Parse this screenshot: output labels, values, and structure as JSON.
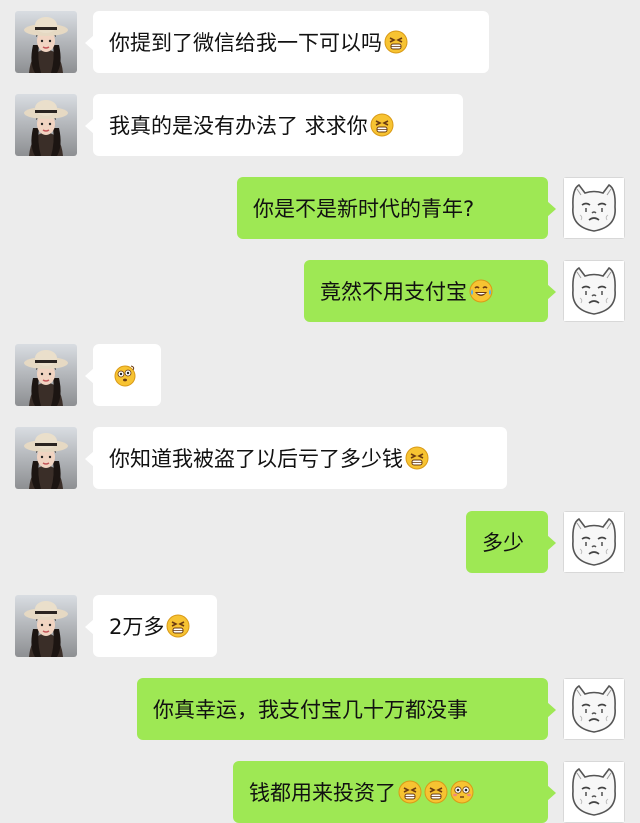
{
  "contact": {
    "avatar": "woman-straw-hat-avatar"
  },
  "self": {
    "avatar": "white-cat-cartoon-avatar"
  },
  "colors": {
    "background": "#ececec",
    "incoming_bubble": "#ffffff",
    "outgoing_bubble": "#9ee854",
    "text": "#111111"
  },
  "messages": [
    {
      "side": "in",
      "text": "你提到了微信给我一下可以吗",
      "emoji": [
        "grimace-emoji"
      ]
    },
    {
      "side": "in",
      "text": "我真的是没有办法了 求求你",
      "emoji": [
        "grimace-emoji"
      ]
    },
    {
      "side": "out",
      "text": "你是不是新时代的青年?",
      "emoji": []
    },
    {
      "side": "out",
      "text": "竟然不用支付宝",
      "emoji": [
        "tears-of-joy-emoji"
      ]
    },
    {
      "side": "in",
      "text": "",
      "emoji": [
        "dizzy-emoji"
      ]
    },
    {
      "side": "in",
      "text": "你知道我被盗了以后亏了多少钱",
      "emoji": [
        "grimace-emoji"
      ]
    },
    {
      "side": "out",
      "text": "多少",
      "emoji": []
    },
    {
      "side": "in",
      "text": "2万多",
      "emoji": [
        "grimace-emoji"
      ]
    },
    {
      "side": "out",
      "text": "你真幸运，我支付宝几十万都没事",
      "emoji": []
    },
    {
      "side": "out",
      "text": "钱都用来投资了",
      "emoji": [
        "grimace-emoji",
        "grimace-emoji",
        "flushed-emoji"
      ]
    }
  ]
}
